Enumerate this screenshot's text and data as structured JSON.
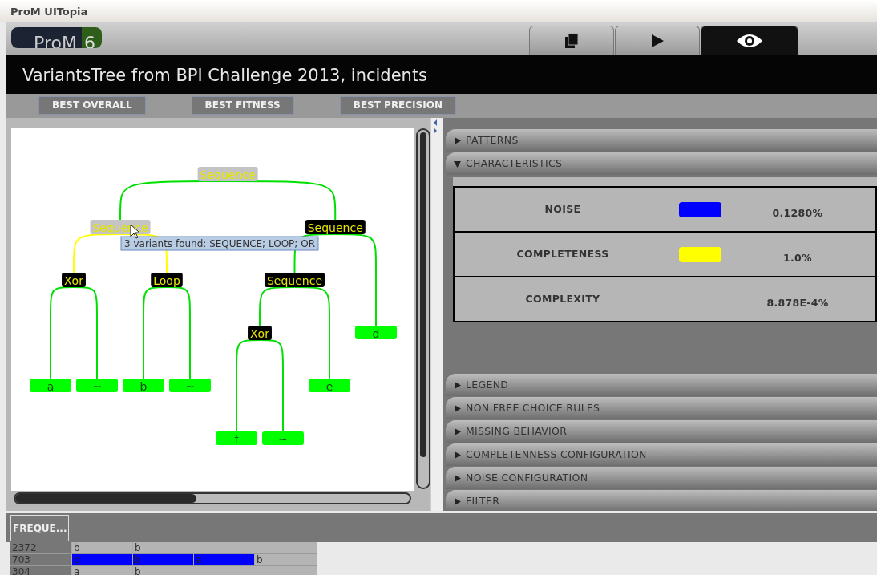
{
  "window": {
    "title": "ProM UITopia"
  },
  "logo": {
    "name": "ProM",
    "version": "6"
  },
  "view_tabs": [
    {
      "selected": false
    },
    {
      "selected": false
    },
    {
      "selected": true
    }
  ],
  "title": "VariantsTree from BPI Challenge 2013, incidents",
  "buttons": [
    "BEST OVERALL",
    "BEST FITNESS",
    "BEST PRECISION"
  ],
  "tree": {
    "label": "Sequence",
    "selected": true,
    "children": [
      {
        "label": "Sequence",
        "selected": true,
        "tooltip": "3 variants found: SEQUENCE; LOOP; OR",
        "children": [
          {
            "label": "Xor",
            "selected": false,
            "children": [
              {
                "label": "a"
              },
              {
                "label": "~"
              }
            ]
          },
          {
            "label": "Loop",
            "selected": false,
            "children": [
              {
                "label": "b"
              },
              {
                "label": "~"
              }
            ]
          }
        ]
      },
      {
        "label": "Sequence",
        "selected": false,
        "children": [
          {
            "label": "Sequence",
            "selected": false,
            "children": [
              {
                "label": "Xor",
                "selected": false,
                "children": [
                  {
                    "label": "f"
                  },
                  {
                    "label": "~"
                  }
                ]
              },
              {
                "label": "e"
              }
            ]
          },
          {
            "label": "d"
          }
        ]
      }
    ]
  },
  "sections": [
    {
      "title": "PATTERNS",
      "expanded": false
    },
    {
      "title": "CHARACTERISTICS",
      "expanded": true,
      "rows": [
        {
          "label": "NOISE",
          "color": "#0000ff",
          "value": "0.1280%"
        },
        {
          "label": "COMPLETENESS",
          "color": "#ffff00",
          "value": "1.0%"
        },
        {
          "label": "COMPLEXITY",
          "value": "8.878E-4%"
        }
      ]
    },
    {
      "title": "LEGEND",
      "expanded": false
    },
    {
      "title": "NON FREE CHOICE RULES",
      "expanded": false
    },
    {
      "title": "MISSING BEHAVIOR",
      "expanded": false
    },
    {
      "title": "COMPLETENNESS CONFIGURATION",
      "expanded": false
    },
    {
      "title": "NOISE CONFIGURATION",
      "expanded": false
    },
    {
      "title": "FILTER",
      "expanded": false
    }
  ],
  "variants_table": {
    "header": "FREQUE...",
    "rows": [
      {
        "frequency": "2372",
        "cells": [
          {
            "text": "b",
            "selected": false
          },
          {
            "text": "b",
            "selected": false
          }
        ]
      },
      {
        "frequency": "703",
        "cells": [
          {
            "text": "b",
            "selected": true
          },
          {
            "text": "b",
            "selected": true
          },
          {
            "text": "a",
            "selected": true
          },
          {
            "text": "b",
            "selected": false
          }
        ]
      },
      {
        "frequency": "304",
        "cells": [
          {
            "text": "a",
            "selected": false
          },
          {
            "text": "b",
            "selected": false
          }
        ]
      }
    ]
  }
}
